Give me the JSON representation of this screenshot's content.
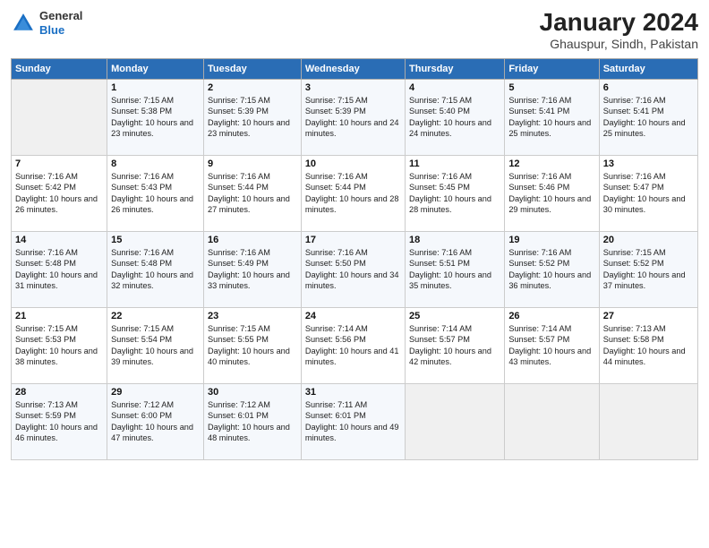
{
  "header": {
    "logo": {
      "general": "General",
      "blue": "Blue"
    },
    "title": "January 2024",
    "subtitle": "Ghauspur, Sindh, Pakistan"
  },
  "calendar": {
    "days": [
      "Sunday",
      "Monday",
      "Tuesday",
      "Wednesday",
      "Thursday",
      "Friday",
      "Saturday"
    ],
    "weeks": [
      [
        {
          "num": "",
          "empty": true
        },
        {
          "num": "1",
          "sunrise": "7:15 AM",
          "sunset": "5:38 PM",
          "daylight": "10 hours and 23 minutes."
        },
        {
          "num": "2",
          "sunrise": "7:15 AM",
          "sunset": "5:39 PM",
          "daylight": "10 hours and 23 minutes."
        },
        {
          "num": "3",
          "sunrise": "7:15 AM",
          "sunset": "5:39 PM",
          "daylight": "10 hours and 24 minutes."
        },
        {
          "num": "4",
          "sunrise": "7:15 AM",
          "sunset": "5:40 PM",
          "daylight": "10 hours and 24 minutes."
        },
        {
          "num": "5",
          "sunrise": "7:16 AM",
          "sunset": "5:41 PM",
          "daylight": "10 hours and 25 minutes."
        },
        {
          "num": "6",
          "sunrise": "7:16 AM",
          "sunset": "5:41 PM",
          "daylight": "10 hours and 25 minutes."
        }
      ],
      [
        {
          "num": "7",
          "sunrise": "7:16 AM",
          "sunset": "5:42 PM",
          "daylight": "10 hours and 26 minutes."
        },
        {
          "num": "8",
          "sunrise": "7:16 AM",
          "sunset": "5:43 PM",
          "daylight": "10 hours and 26 minutes."
        },
        {
          "num": "9",
          "sunrise": "7:16 AM",
          "sunset": "5:44 PM",
          "daylight": "10 hours and 27 minutes."
        },
        {
          "num": "10",
          "sunrise": "7:16 AM",
          "sunset": "5:44 PM",
          "daylight": "10 hours and 28 minutes."
        },
        {
          "num": "11",
          "sunrise": "7:16 AM",
          "sunset": "5:45 PM",
          "daylight": "10 hours and 28 minutes."
        },
        {
          "num": "12",
          "sunrise": "7:16 AM",
          "sunset": "5:46 PM",
          "daylight": "10 hours and 29 minutes."
        },
        {
          "num": "13",
          "sunrise": "7:16 AM",
          "sunset": "5:47 PM",
          "daylight": "10 hours and 30 minutes."
        }
      ],
      [
        {
          "num": "14",
          "sunrise": "7:16 AM",
          "sunset": "5:48 PM",
          "daylight": "10 hours and 31 minutes."
        },
        {
          "num": "15",
          "sunrise": "7:16 AM",
          "sunset": "5:48 PM",
          "daylight": "10 hours and 32 minutes."
        },
        {
          "num": "16",
          "sunrise": "7:16 AM",
          "sunset": "5:49 PM",
          "daylight": "10 hours and 33 minutes."
        },
        {
          "num": "17",
          "sunrise": "7:16 AM",
          "sunset": "5:50 PM",
          "daylight": "10 hours and 34 minutes."
        },
        {
          "num": "18",
          "sunrise": "7:16 AM",
          "sunset": "5:51 PM",
          "daylight": "10 hours and 35 minutes."
        },
        {
          "num": "19",
          "sunrise": "7:16 AM",
          "sunset": "5:52 PM",
          "daylight": "10 hours and 36 minutes."
        },
        {
          "num": "20",
          "sunrise": "7:15 AM",
          "sunset": "5:52 PM",
          "daylight": "10 hours and 37 minutes."
        }
      ],
      [
        {
          "num": "21",
          "sunrise": "7:15 AM",
          "sunset": "5:53 PM",
          "daylight": "10 hours and 38 minutes."
        },
        {
          "num": "22",
          "sunrise": "7:15 AM",
          "sunset": "5:54 PM",
          "daylight": "10 hours and 39 minutes."
        },
        {
          "num": "23",
          "sunrise": "7:15 AM",
          "sunset": "5:55 PM",
          "daylight": "10 hours and 40 minutes."
        },
        {
          "num": "24",
          "sunrise": "7:14 AM",
          "sunset": "5:56 PM",
          "daylight": "10 hours and 41 minutes."
        },
        {
          "num": "25",
          "sunrise": "7:14 AM",
          "sunset": "5:57 PM",
          "daylight": "10 hours and 42 minutes."
        },
        {
          "num": "26",
          "sunrise": "7:14 AM",
          "sunset": "5:57 PM",
          "daylight": "10 hours and 43 minutes."
        },
        {
          "num": "27",
          "sunrise": "7:13 AM",
          "sunset": "5:58 PM",
          "daylight": "10 hours and 44 minutes."
        }
      ],
      [
        {
          "num": "28",
          "sunrise": "7:13 AM",
          "sunset": "5:59 PM",
          "daylight": "10 hours and 46 minutes."
        },
        {
          "num": "29",
          "sunrise": "7:12 AM",
          "sunset": "6:00 PM",
          "daylight": "10 hours and 47 minutes."
        },
        {
          "num": "30",
          "sunrise": "7:12 AM",
          "sunset": "6:01 PM",
          "daylight": "10 hours and 48 minutes."
        },
        {
          "num": "31",
          "sunrise": "7:11 AM",
          "sunset": "6:01 PM",
          "daylight": "10 hours and 49 minutes."
        },
        {
          "num": "",
          "empty": true
        },
        {
          "num": "",
          "empty": true
        },
        {
          "num": "",
          "empty": true
        }
      ]
    ]
  }
}
